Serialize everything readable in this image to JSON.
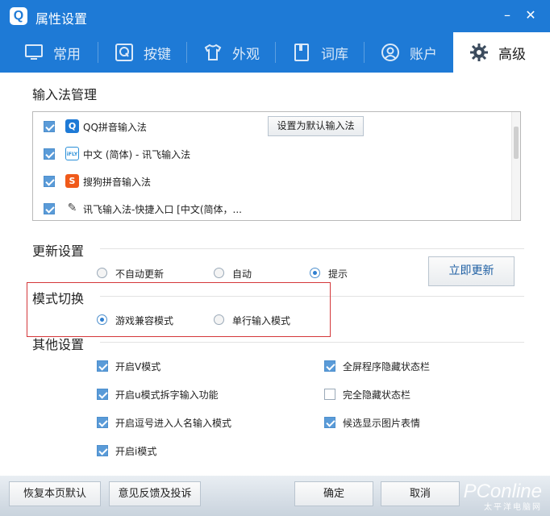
{
  "window": {
    "title": "属性设置",
    "logo_letter": "Q",
    "minimize": "–",
    "close": "✕"
  },
  "tabs": [
    {
      "label": "常用",
      "icon": "monitor-icon"
    },
    {
      "label": "按键",
      "icon": "q-key-icon"
    },
    {
      "label": "外观",
      "icon": "tshirt-icon"
    },
    {
      "label": "词库",
      "icon": "book-icon"
    },
    {
      "label": "账户",
      "icon": "user-icon"
    },
    {
      "label": "高级",
      "icon": "gear-icon",
      "active": true
    }
  ],
  "ime": {
    "title": "输入法管理",
    "set_default_button": "设置为默认输入法",
    "items": [
      {
        "label": "QQ拼音输入法",
        "checked": true,
        "icon": "Q",
        "color": "#1e7ad6"
      },
      {
        "label": "中文 (简体) - 讯飞输入法",
        "checked": true,
        "icon": "iFLY",
        "color": "#2a8fd8"
      },
      {
        "label": "搜狗拼音输入法",
        "checked": true,
        "icon": "S",
        "color": "#f05a1a"
      },
      {
        "label": "讯飞输入法-快捷入口 [中文(简体，...",
        "checked": true,
        "icon": "✎",
        "color": "#444444"
      }
    ]
  },
  "update": {
    "title": "更新设置",
    "options": [
      "不自动更新",
      "自动",
      "提示"
    ],
    "selected": "提示",
    "update_now_button": "立即更新"
  },
  "mode": {
    "title": "模式切换",
    "options": [
      "游戏兼容模式",
      "单行输入模式"
    ],
    "selected": "游戏兼容模式"
  },
  "other": {
    "title": "其他设置",
    "left": [
      {
        "label": "开启V模式",
        "checked": true
      },
      {
        "label": "开启u模式拆字输入功能",
        "checked": true
      },
      {
        "label": "开启逗号进入人名输入模式",
        "checked": true
      },
      {
        "label": "开启i模式",
        "checked": true
      }
    ],
    "right": [
      {
        "label": "全屏程序隐藏状态栏",
        "checked": true
      },
      {
        "label": "完全隐藏状态栏",
        "checked": false
      },
      {
        "label": "候选显示图片表情",
        "checked": true
      }
    ]
  },
  "footer": {
    "restore_button": "恢复本页默认",
    "feedback_button": "意见反馈及投诉",
    "ok_button": "确定",
    "cancel_button": "取消"
  },
  "watermark": {
    "text": "PConline",
    "sub": "太平洋电脑网"
  },
  "colors": {
    "accent": "#1e7ad6",
    "highlight_border": "#d4373a"
  }
}
